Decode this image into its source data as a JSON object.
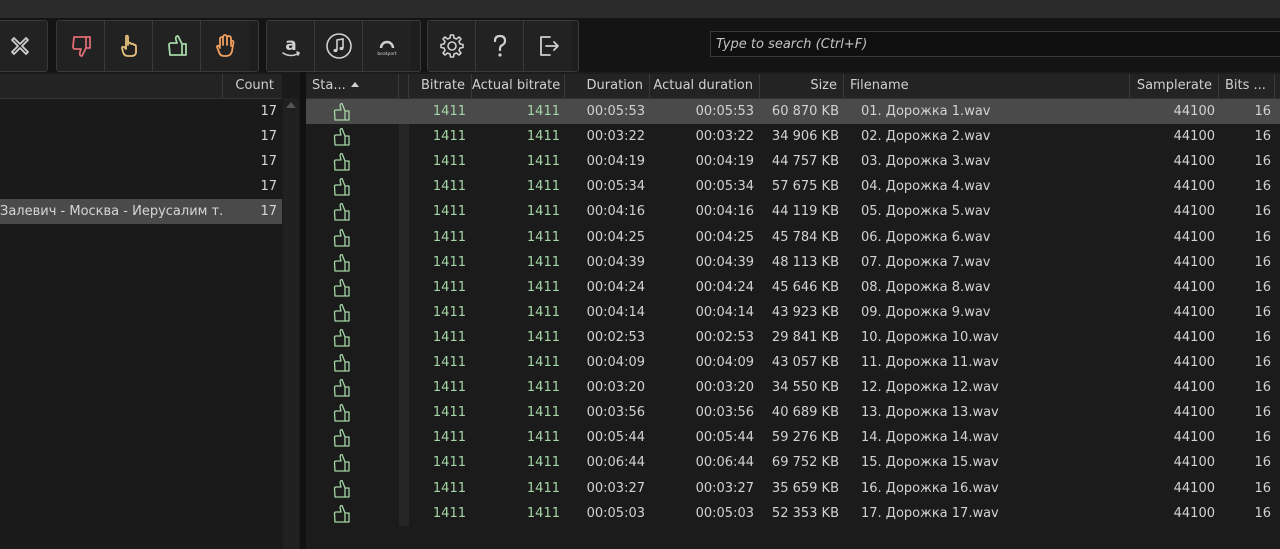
{
  "search": {
    "placeholder": "Type to search (Ctrl+F)"
  },
  "toolbar": {
    "groups": [
      [
        "close-icon"
      ],
      [
        "thumbs-down-icon",
        "pointing-hand-icon",
        "thumbs-up-icon",
        "raised-hand-icon"
      ],
      [
        "amazon-icon",
        "music-note-icon",
        "beatport-icon"
      ],
      [
        "gear-icon",
        "help-icon",
        "exit-icon"
      ]
    ],
    "beatport_text": "beatport",
    "colors": {
      "thumbs_down": "#e06c75",
      "pointing_hand": "#e5c07b",
      "thumbs_up": "#a5d6a7",
      "raised_hand": "#f0a060"
    }
  },
  "left_panel": {
    "count_header": "Count",
    "rows": [
      {
        "text": "",
        "count": "17"
      },
      {
        "text": "",
        "count": "17"
      },
      {
        "text": "",
        "count": "17"
      },
      {
        "text": "",
        "count": "17"
      },
      {
        "text": "Залевич - Москва - Иерусалим т...",
        "count": "17"
      }
    ]
  },
  "table": {
    "headers": {
      "status": "Sta...",
      "bitrate": "Bitrate",
      "actual_bitrate": "Actual bitrate",
      "duration": "Duration",
      "actual_duration": "Actual duration",
      "size": "Size",
      "filename": "Filename",
      "samplerate": "Samplerate",
      "bits": "Bits ..."
    },
    "rows": [
      {
        "bitrate": "1411",
        "actual_bitrate": "1411",
        "duration": "00:05:53",
        "actual_duration": "00:05:53",
        "size": "60 870 KB",
        "filename": "01. Дорожка 1.wav",
        "samplerate": "44100",
        "bits": "16"
      },
      {
        "bitrate": "1411",
        "actual_bitrate": "1411",
        "duration": "00:03:22",
        "actual_duration": "00:03:22",
        "size": "34 906 KB",
        "filename": "02. Дорожка 2.wav",
        "samplerate": "44100",
        "bits": "16"
      },
      {
        "bitrate": "1411",
        "actual_bitrate": "1411",
        "duration": "00:04:19",
        "actual_duration": "00:04:19",
        "size": "44 757 KB",
        "filename": "03. Дорожка 3.wav",
        "samplerate": "44100",
        "bits": "16"
      },
      {
        "bitrate": "1411",
        "actual_bitrate": "1411",
        "duration": "00:05:34",
        "actual_duration": "00:05:34",
        "size": "57 675 KB",
        "filename": "04. Дорожка 4.wav",
        "samplerate": "44100",
        "bits": "16"
      },
      {
        "bitrate": "1411",
        "actual_bitrate": "1411",
        "duration": "00:04:16",
        "actual_duration": "00:04:16",
        "size": "44 119 KB",
        "filename": "05. Дорожка 5.wav",
        "samplerate": "44100",
        "bits": "16"
      },
      {
        "bitrate": "1411",
        "actual_bitrate": "1411",
        "duration": "00:04:25",
        "actual_duration": "00:04:25",
        "size": "45 784 KB",
        "filename": "06. Дорожка 6.wav",
        "samplerate": "44100",
        "bits": "16"
      },
      {
        "bitrate": "1411",
        "actual_bitrate": "1411",
        "duration": "00:04:39",
        "actual_duration": "00:04:39",
        "size": "48 113 KB",
        "filename": "07. Дорожка 7.wav",
        "samplerate": "44100",
        "bits": "16"
      },
      {
        "bitrate": "1411",
        "actual_bitrate": "1411",
        "duration": "00:04:24",
        "actual_duration": "00:04:24",
        "size": "45 646 KB",
        "filename": "08. Дорожка 8.wav",
        "samplerate": "44100",
        "bits": "16"
      },
      {
        "bitrate": "1411",
        "actual_bitrate": "1411",
        "duration": "00:04:14",
        "actual_duration": "00:04:14",
        "size": "43 923 KB",
        "filename": "09. Дорожка 9.wav",
        "samplerate": "44100",
        "bits": "16"
      },
      {
        "bitrate": "1411",
        "actual_bitrate": "1411",
        "duration": "00:02:53",
        "actual_duration": "00:02:53",
        "size": "29 841 KB",
        "filename": "10. Дорожка 10.wav",
        "samplerate": "44100",
        "bits": "16"
      },
      {
        "bitrate": "1411",
        "actual_bitrate": "1411",
        "duration": "00:04:09",
        "actual_duration": "00:04:09",
        "size": "43 057 KB",
        "filename": "11. Дорожка 11.wav",
        "samplerate": "44100",
        "bits": "16"
      },
      {
        "bitrate": "1411",
        "actual_bitrate": "1411",
        "duration": "00:03:20",
        "actual_duration": "00:03:20",
        "size": "34 550 KB",
        "filename": "12. Дорожка 12.wav",
        "samplerate": "44100",
        "bits": "16"
      },
      {
        "bitrate": "1411",
        "actual_bitrate": "1411",
        "duration": "00:03:56",
        "actual_duration": "00:03:56",
        "size": "40 689 KB",
        "filename": "13. Дорожка 13.wav",
        "samplerate": "44100",
        "bits": "16"
      },
      {
        "bitrate": "1411",
        "actual_bitrate": "1411",
        "duration": "00:05:44",
        "actual_duration": "00:05:44",
        "size": "59 276 KB",
        "filename": "14. Дорожка 14.wav",
        "samplerate": "44100",
        "bits": "16"
      },
      {
        "bitrate": "1411",
        "actual_bitrate": "1411",
        "duration": "00:06:44",
        "actual_duration": "00:06:44",
        "size": "69 752 KB",
        "filename": "15. Дорожка 15.wav",
        "samplerate": "44100",
        "bits": "16"
      },
      {
        "bitrate": "1411",
        "actual_bitrate": "1411",
        "duration": "00:03:27",
        "actual_duration": "00:03:27",
        "size": "35 659 KB",
        "filename": "16. Дорожка 16.wav",
        "samplerate": "44100",
        "bits": "16"
      },
      {
        "bitrate": "1411",
        "actual_bitrate": "1411",
        "duration": "00:05:03",
        "actual_duration": "00:05:03",
        "size": "52 353 KB",
        "filename": "17. Дорожка 17.wav",
        "samplerate": "44100",
        "bits": "16"
      }
    ]
  }
}
